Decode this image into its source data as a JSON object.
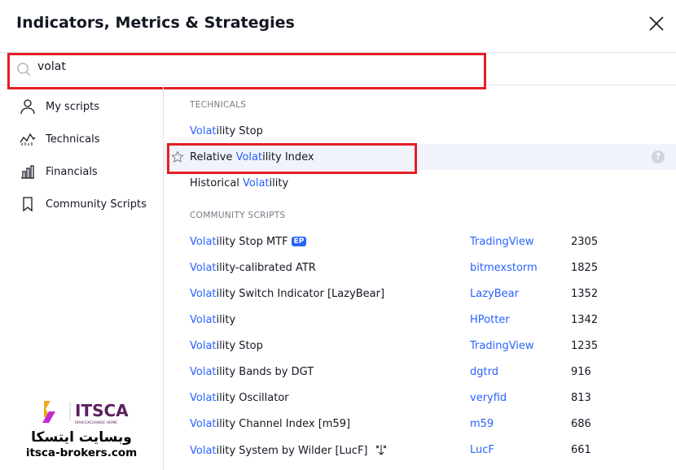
{
  "title": "Indicators, Metrics & Strategies",
  "search": {
    "value": "volat"
  },
  "sidebar": {
    "items": [
      {
        "label": "My scripts",
        "icon": "user-icon"
      },
      {
        "label": "Technicals",
        "icon": "chart-icon"
      },
      {
        "label": "Financials",
        "icon": "bar-chart-icon"
      },
      {
        "label": "Community Scripts",
        "icon": "bookmark-icon"
      }
    ]
  },
  "technicals": {
    "header": "TECHNICALS",
    "items": [
      {
        "hi": "Volat",
        "rest_before": "",
        "rest": "ility Stop"
      },
      {
        "hi": "Volat",
        "rest_before": "Relative ",
        "rest": "ility Index"
      },
      {
        "hi": "Volat",
        "rest_before": "Historical ",
        "rest": "ility"
      }
    ]
  },
  "community": {
    "header": "COMMUNITY SCRIPTS",
    "items": [
      {
        "hi": "Volat",
        "rest": "ility Stop MTF",
        "badge": "EP",
        "author": "TradingView",
        "count": "2305"
      },
      {
        "hi": "Volat",
        "rest": "ility-calibrated ATR",
        "author": "bitmexstorm",
        "count": "1825"
      },
      {
        "hi": "Volat",
        "rest": "ility Switch Indicator [LazyBear]",
        "author": "LazyBear",
        "count": "1352"
      },
      {
        "hi": "Volat",
        "rest": "ility",
        "author": "HPotter",
        "count": "1342"
      },
      {
        "hi": "Volat",
        "rest": "ility Stop",
        "author": "TradingView",
        "count": "1235"
      },
      {
        "hi": "Volat",
        "rest": "ility Bands by DGT",
        "author": "dgtrd",
        "count": "916"
      },
      {
        "hi": "Volat",
        "rest": "ility Oscillator",
        "author": "veryfid",
        "count": "813"
      },
      {
        "hi": "Volat",
        "rest": "ility Channel Index [m59]",
        "author": "m59",
        "count": "686"
      },
      {
        "hi": "Volat",
        "rest": "ility System by Wilder [LucF]",
        "author": "LucF",
        "count": "661"
      }
    ]
  },
  "watermark": {
    "brand": "ITSCA",
    "tagline": "IRAN EXCHANGE HOME",
    "persian": "وبسایت ایتسکا",
    "url": "itsca-brokers.com"
  },
  "colors": {
    "accent": "#2962ff",
    "highlight_box": "#e41e26",
    "row_hover": "#f0f3fa"
  }
}
